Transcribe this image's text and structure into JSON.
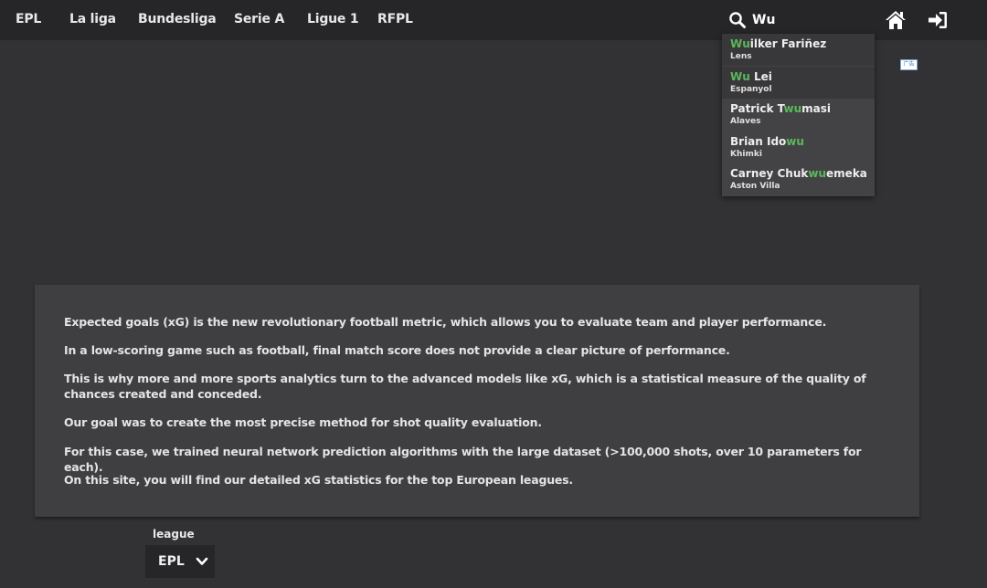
{
  "nav": {
    "items": [
      "EPL",
      "La liga",
      "Bundesliga",
      "Serie A",
      "Ligue 1",
      "RFPL"
    ]
  },
  "search": {
    "value": "Wu",
    "icon": "search-icon"
  },
  "header_icons": [
    "home-icon",
    "sign-in-icon"
  ],
  "suggestions": [
    {
      "name_before": "",
      "name_match": "Wu",
      "name_after": "ilker Fariñez",
      "team": "Lens"
    },
    {
      "name_before": "",
      "name_match": "Wu",
      "name_after": " Lei",
      "team": "Espanyol"
    },
    {
      "name_before": "Patrick T",
      "name_match": "wu",
      "name_after": "masi",
      "team": "Alaves"
    },
    {
      "name_before": "Brian Ido",
      "name_match": "wu",
      "name_after": "",
      "team": "Khimki"
    },
    {
      "name_before": "Carney Chuk",
      "name_match": "wu",
      "name_after": "emeka",
      "team": "Aston Villa"
    }
  ],
  "ad_label": "广告",
  "intro": {
    "paragraphs": [
      "Expected goals (xG) is the new revolutionary football metric, which allows you to evaluate team and player performance.",
      "In a low-scoring game such as football, final match score does not provide a clear picture of performance.",
      "This is why more and more sports analytics turn to the advanced models like xG, which is a statistical measure of the quality of chances created and conceded.",
      "Our goal was to create the most precise method for shot quality evaluation.",
      "For this case, we trained neural network prediction algorithms with the large dataset (>100,000 shots, over 10 parameters for each).",
      "On this site, you will find our detailed xG statistics for the top European leagues."
    ]
  },
  "league_filter": {
    "label": "league",
    "selected": "EPL"
  },
  "colors": {
    "background": "#323234",
    "topbar": "#262628",
    "highlight": "#5cb85c",
    "panel": "#3f3f41"
  }
}
